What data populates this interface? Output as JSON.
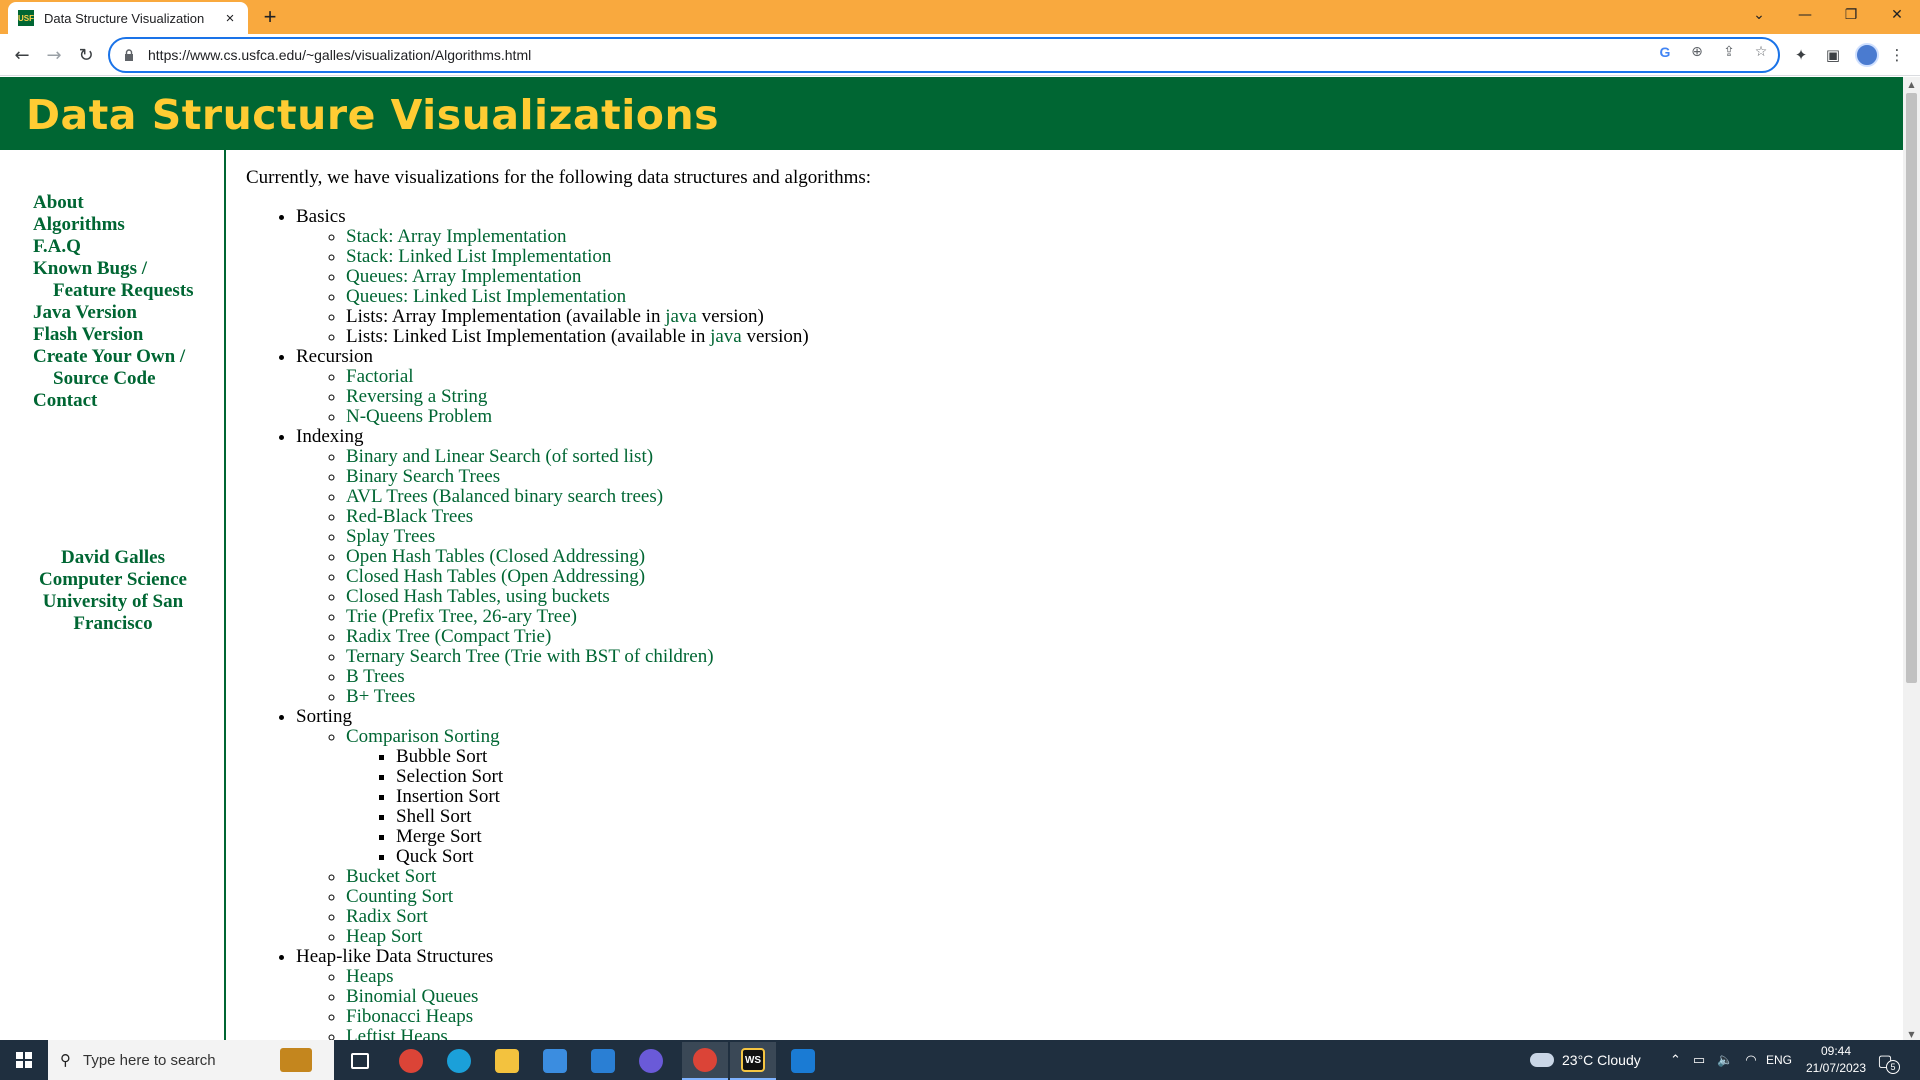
{
  "browser": {
    "tab_title": "Data Structure Visualization",
    "favicon_text": "USF",
    "tab_close_icon": "×",
    "new_tab_icon": "+",
    "url": "https://www.cs.usfca.edu/~galles/visualization/Algorithms.html"
  },
  "page": {
    "header_title": "Data Structure Visualizations",
    "intro": "Currently, we have visualizations for the following data structures and algorithms:",
    "sidebar": {
      "about": "About",
      "algorithms": "Algorithms",
      "faq": "F.A.Q",
      "known_bugs": "Known Bugs /",
      "feature_requests": "Feature Requests",
      "java_version": "Java Version",
      "flash_version": "Flash Version",
      "create_your_own": "Create Your Own /",
      "source_code": "Source Code",
      "contact": "Contact"
    },
    "author": {
      "name": "David Galles",
      "dept": "Computer Science",
      "univ": "University of San Francisco"
    },
    "basics": {
      "label": "Basics",
      "items": [
        "Stack: Array Implementation",
        "Stack: Linked List Implementation",
        "Queues: Array Implementation",
        "Queues: Linked List Implementation"
      ],
      "list_array_pre": "Lists: Array Implementation (available in ",
      "list_linked_pre": "Lists: Linked List Implementation (available in ",
      "java": "java",
      "version_post": " version)"
    },
    "recursion": {
      "label": "Recursion",
      "items": [
        "Factorial",
        "Reversing a String",
        "N-Queens Problem"
      ]
    },
    "indexing": {
      "label": "Indexing",
      "items": [
        "Binary and Linear Search (of sorted list)",
        "Binary Search Trees",
        "AVL Trees (Balanced binary search trees)",
        "Red-Black Trees",
        "Splay Trees",
        "Open Hash Tables (Closed Addressing)",
        "Closed Hash Tables (Open Addressing)",
        "Closed Hash Tables, using buckets",
        "Trie (Prefix Tree, 26-ary Tree)",
        "Radix Tree (Compact Trie)",
        "Ternary Search Tree (Trie with BST of children)",
        "B Trees",
        "B+ Trees"
      ]
    },
    "sorting": {
      "label": "Sorting",
      "comparison": "Comparison Sorting",
      "comparison_items": [
        "Bubble Sort",
        "Selection Sort",
        "Insertion Sort",
        "Shell Sort",
        "Merge Sort",
        "Quck Sort"
      ],
      "items": [
        "Bucket Sort",
        "Counting Sort",
        "Radix Sort",
        "Heap Sort"
      ]
    },
    "heaps": {
      "label": "Heap-like Data Structures",
      "items": [
        "Heaps",
        "Binomial Queues",
        "Fibonacci Heaps",
        "Leftist Heaps"
      ]
    }
  },
  "taskbar": {
    "search_placeholder": "Type here to search",
    "weather": "23°C  Cloudy",
    "lang": "ENG",
    "time": "09:44",
    "date": "21/07/2023",
    "notification_count": "5"
  }
}
